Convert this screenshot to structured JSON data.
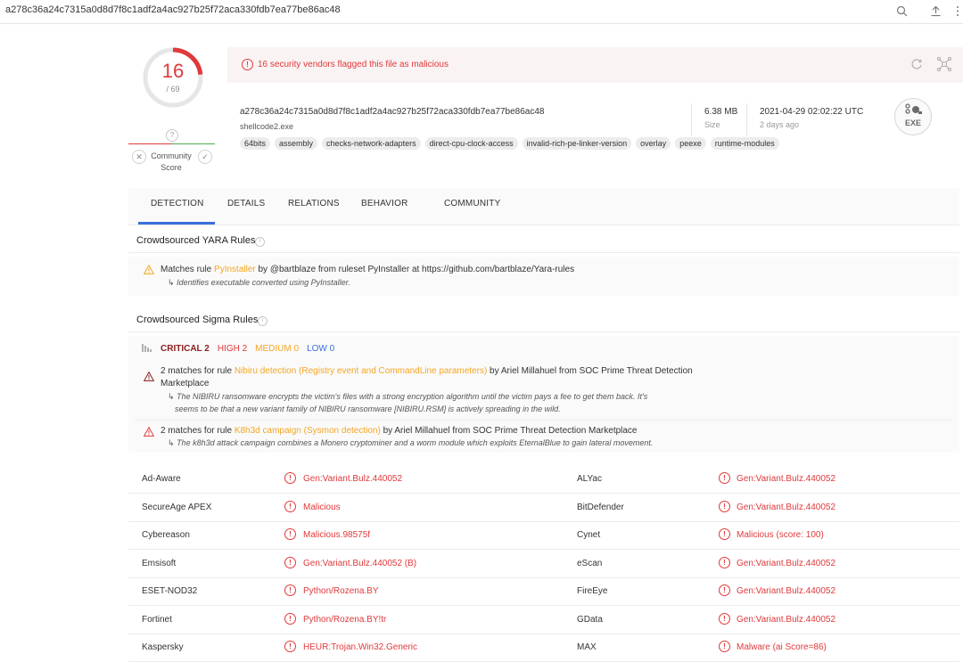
{
  "topbar": {
    "hash": "a278c36a24c7315a0d8d7f8c1adf2a4ac927b25f72aca330fdb7ea77be86ac48"
  },
  "score": {
    "detections": "16",
    "total": "/ 69",
    "community_unknown": "?",
    "community_label_1": "Community",
    "community_label_2": "Score",
    "colors": {
      "malicious": "#e0393b",
      "ring_bg": "#e6e6e6"
    }
  },
  "alert": {
    "icon": "!",
    "message": "16 security vendors flagged this file as malicious"
  },
  "file": {
    "hash": "a278c36a24c7315a0d8d7f8c1adf2a4ac927b25f72aca330fdb7ea77be86ac48",
    "name": "shellcode2.exe",
    "tags": [
      "64bits",
      "assembly",
      "checks-network-adapters",
      "direct-cpu-clock-access",
      "invalid-rich-pe-linker-version",
      "overlay",
      "peexe",
      "runtime-modules"
    ],
    "size_value": "6.38 MB",
    "size_label": "Size",
    "date_value": "2021-04-29 02:02:22 UTC",
    "date_label": "2 days ago",
    "type_label": "EXE"
  },
  "tabs": [
    {
      "label": "DETECTION"
    },
    {
      "label": "DETAILS"
    },
    {
      "label": "RELATIONS"
    },
    {
      "label": "BEHAVIOR"
    },
    {
      "label": "COMMUNITY"
    }
  ],
  "yara": {
    "title": "Crowdsourced YARA Rules",
    "rule_prefix": "Matches rule ",
    "rule_name": "PyInstaller",
    "rule_suffix": " by @bartblaze from ruleset PyInstaller at https://github.com/bartblaze/Yara-rules",
    "rule_arrow": "↳",
    "rule_desc": "Identifies executable converted using PyInstaller."
  },
  "sigma": {
    "title": "Crowdsourced Sigma Rules",
    "critical": "CRITICAL 2",
    "high": "HIGH 2",
    "medium": "MEDIUM 0",
    "low": "LOW 0",
    "rules": [
      {
        "prefix": "2 matches for rule ",
        "name": "Nibiru detection (Registry event and CommandLine parameters)",
        "suffix": " by Ariel Millahuel from SOC Prime Threat Detection",
        "suffix2": "Marketplace",
        "desc1": "The NIBIRU ransomware encrypts the victim's files with a strong encryption algorithm until the victim pays a fee to get them back. It's",
        "desc2": "seems to be that a new variant family of NIBIRU ransomware [NIBIRU.RSM] is actively spreading in the wild."
      },
      {
        "prefix": "2 matches for rule ",
        "name": "K8h3d campaign (Sysmon detection)",
        "suffix": " by Ariel Millahuel from SOC Prime Threat Detection Marketplace",
        "desc1": "The k8h3d attack campaign combines a Monero cryptominer and a worm module which exploits EternalBlue to gain lateral movement."
      }
    ]
  },
  "results": [
    {
      "engine1": "Ad-Aware",
      "result1": "Gen:Variant.Bulz.440052",
      "engine2": "ALYac",
      "result2": "Gen:Variant.Bulz.440052"
    },
    {
      "engine1": "SecureAge APEX",
      "result1": "Malicious",
      "engine2": "BitDefender",
      "result2": "Gen:Variant.Bulz.440052"
    },
    {
      "engine1": "Cybereason",
      "result1": "Malicious.98575f",
      "engine2": "Cynet",
      "result2": "Malicious (score: 100)"
    },
    {
      "engine1": "Emsisoft",
      "result1": "Gen:Variant.Bulz.440052 (B)",
      "engine2": "eScan",
      "result2": "Gen:Variant.Bulz.440052"
    },
    {
      "engine1": "ESET-NOD32",
      "result1": "Python/Rozena.BY",
      "engine2": "FireEye",
      "result2": "Gen:Variant.Bulz.440052"
    },
    {
      "engine1": "Fortinet",
      "result1": "Python/Rozena.BY!tr",
      "engine2": "GData",
      "result2": "Gen:Variant.Bulz.440052"
    },
    {
      "engine1": "Kaspersky",
      "result1": "HEUR:Trojan.Win32.Generic",
      "engine2": "MAX",
      "result2": "Malware (ai Score=86)"
    }
  ]
}
